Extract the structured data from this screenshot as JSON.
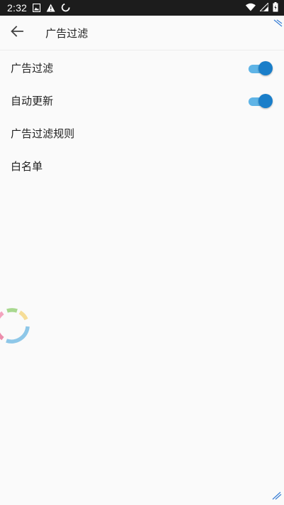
{
  "status_bar": {
    "time": "2:32",
    "left_icons": [
      "image-icon",
      "warning-icon",
      "sync-icon"
    ],
    "right_icons": [
      "wifi-icon",
      "signal-icon",
      "battery-icon"
    ]
  },
  "app_bar": {
    "title": "广告过滤",
    "back_icon": "arrow-back-icon"
  },
  "settings": [
    {
      "label": "广告过滤",
      "type": "switch",
      "checked": true
    },
    {
      "label": "自动更新",
      "type": "switch",
      "checked": true
    },
    {
      "label": "广告过滤规则",
      "type": "link"
    },
    {
      "label": "白名单",
      "type": "link"
    }
  ],
  "colors": {
    "switch_track": "#5fb4e6",
    "switch_thumb": "#1a7ec9",
    "status_bar": "#1c1c1c",
    "background": "#fafafa"
  }
}
